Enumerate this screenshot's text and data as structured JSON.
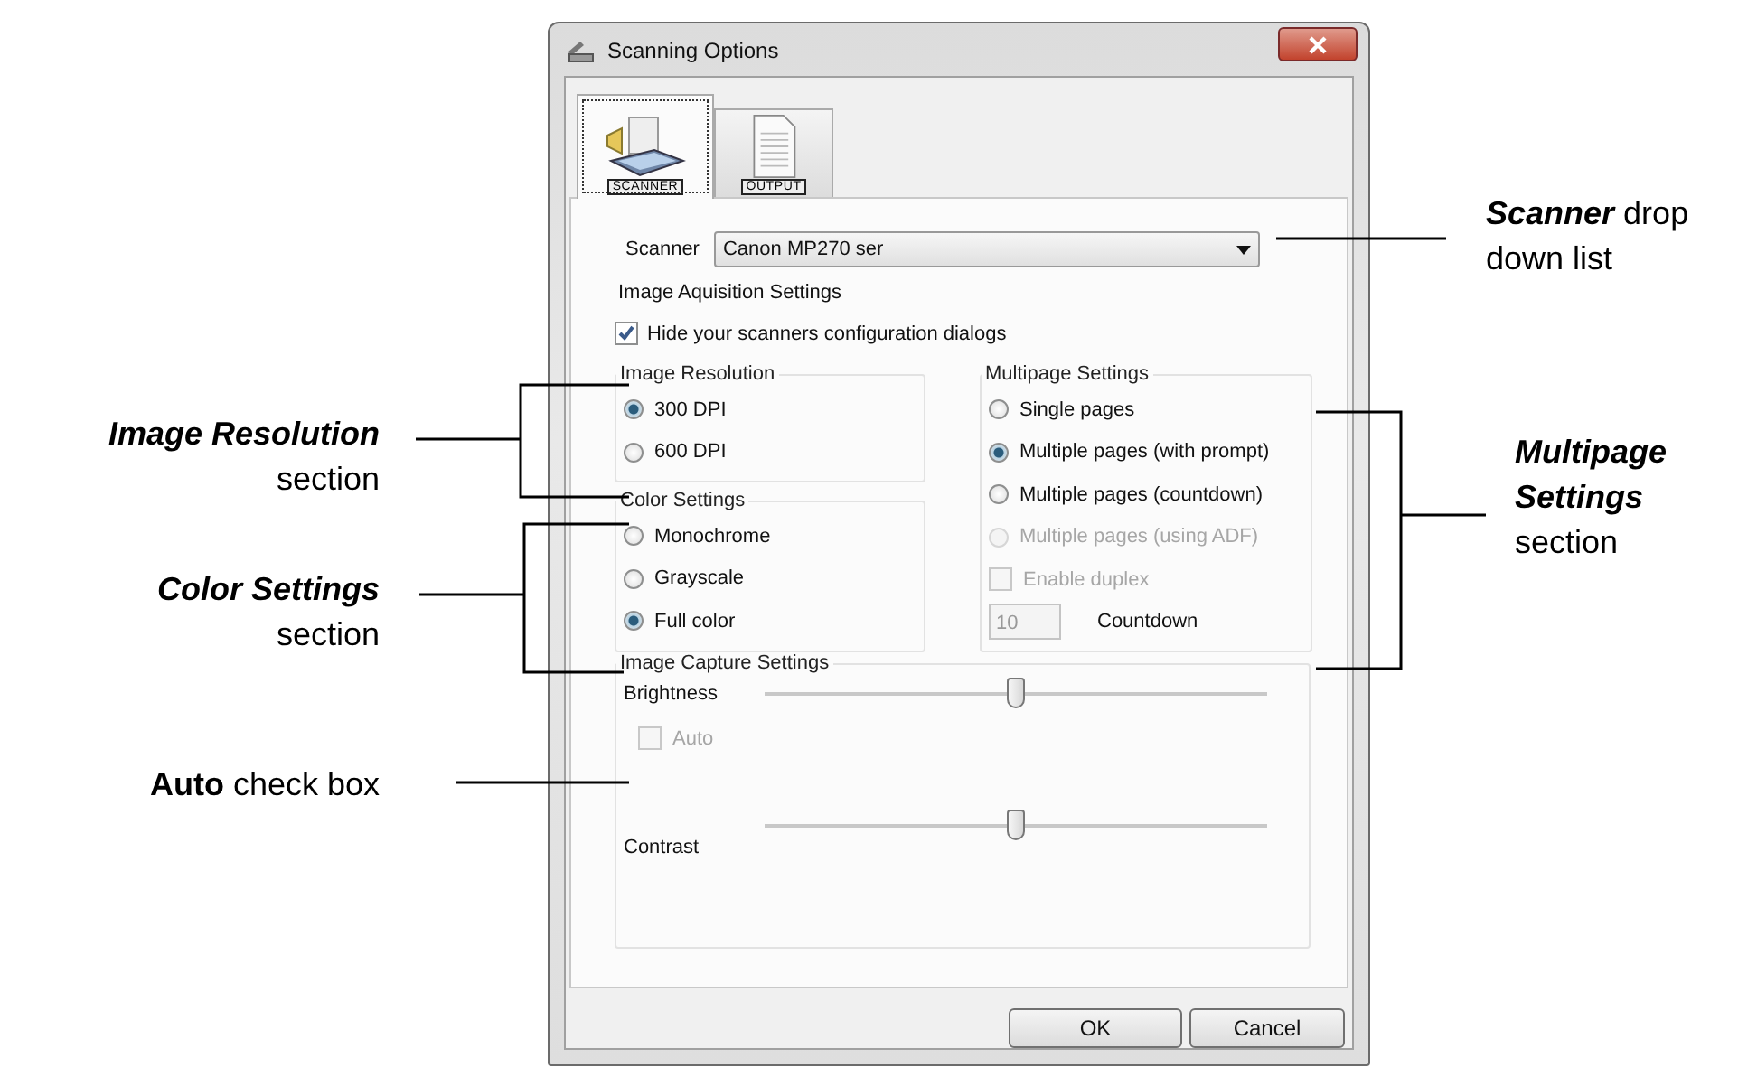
{
  "window": {
    "title": "Scanning Options"
  },
  "tabs": [
    {
      "label": "SCANNER",
      "selected": true
    },
    {
      "label": "OUTPUT",
      "selected": false
    }
  ],
  "scanner": {
    "label": "Scanner",
    "value": "Canon MP270 ser"
  },
  "acquisition": {
    "title": "Image Aquisition Settings",
    "hide_dialogs": {
      "label": "Hide your scanners configuration dialogs",
      "checked": true
    }
  },
  "resolution": {
    "title": "Image Resolution",
    "options": [
      {
        "label": "300 DPI",
        "selected": true,
        "disabled": false
      },
      {
        "label": "600 DPI",
        "selected": false,
        "disabled": false
      }
    ]
  },
  "color": {
    "title": "Color Settings",
    "options": [
      {
        "label": "Monochrome",
        "selected": false,
        "disabled": false
      },
      {
        "label": "Grayscale",
        "selected": false,
        "disabled": false
      },
      {
        "label": "Full color",
        "selected": true,
        "disabled": false
      }
    ]
  },
  "multipage": {
    "title": "Multipage Settings",
    "options": [
      {
        "label": "Single pages",
        "selected": false,
        "disabled": false
      },
      {
        "label": "Multiple pages (with prompt)",
        "selected": true,
        "disabled": false
      },
      {
        "label": "Multiple pages (countdown)",
        "selected": false,
        "disabled": false
      },
      {
        "label": "Multiple pages (using ADF)",
        "selected": false,
        "disabled": true
      }
    ],
    "duplex": {
      "label": "Enable duplex",
      "checked": false,
      "disabled": true
    },
    "countdown": {
      "value": "10",
      "label": "Countdown",
      "disabled": true
    }
  },
  "capture": {
    "title": "Image Capture Settings",
    "brightness": {
      "label": "Brightness",
      "level": 0.5
    },
    "auto": {
      "label": "Auto",
      "checked": false,
      "disabled": true
    },
    "contrast": {
      "label": "Contrast",
      "level": 0.5
    }
  },
  "buttons": [
    "OK",
    "Cancel"
  ],
  "left_callouts": [
    {
      "term": "Image Resolution",
      "text": "section",
      "kind": "emphasis"
    },
    {
      "term": "Color Settings",
      "text": "section",
      "kind": "emphasis"
    },
    {
      "term": "Auto",
      "text": "check box",
      "kind": "strong"
    }
  ],
  "right_callouts": [
    {
      "term": "Scanner",
      "text": "drop down list",
      "kind": "emphasis"
    },
    {
      "term": "Multipage Settings",
      "text": "section",
      "kind": "emphasis"
    }
  ]
}
